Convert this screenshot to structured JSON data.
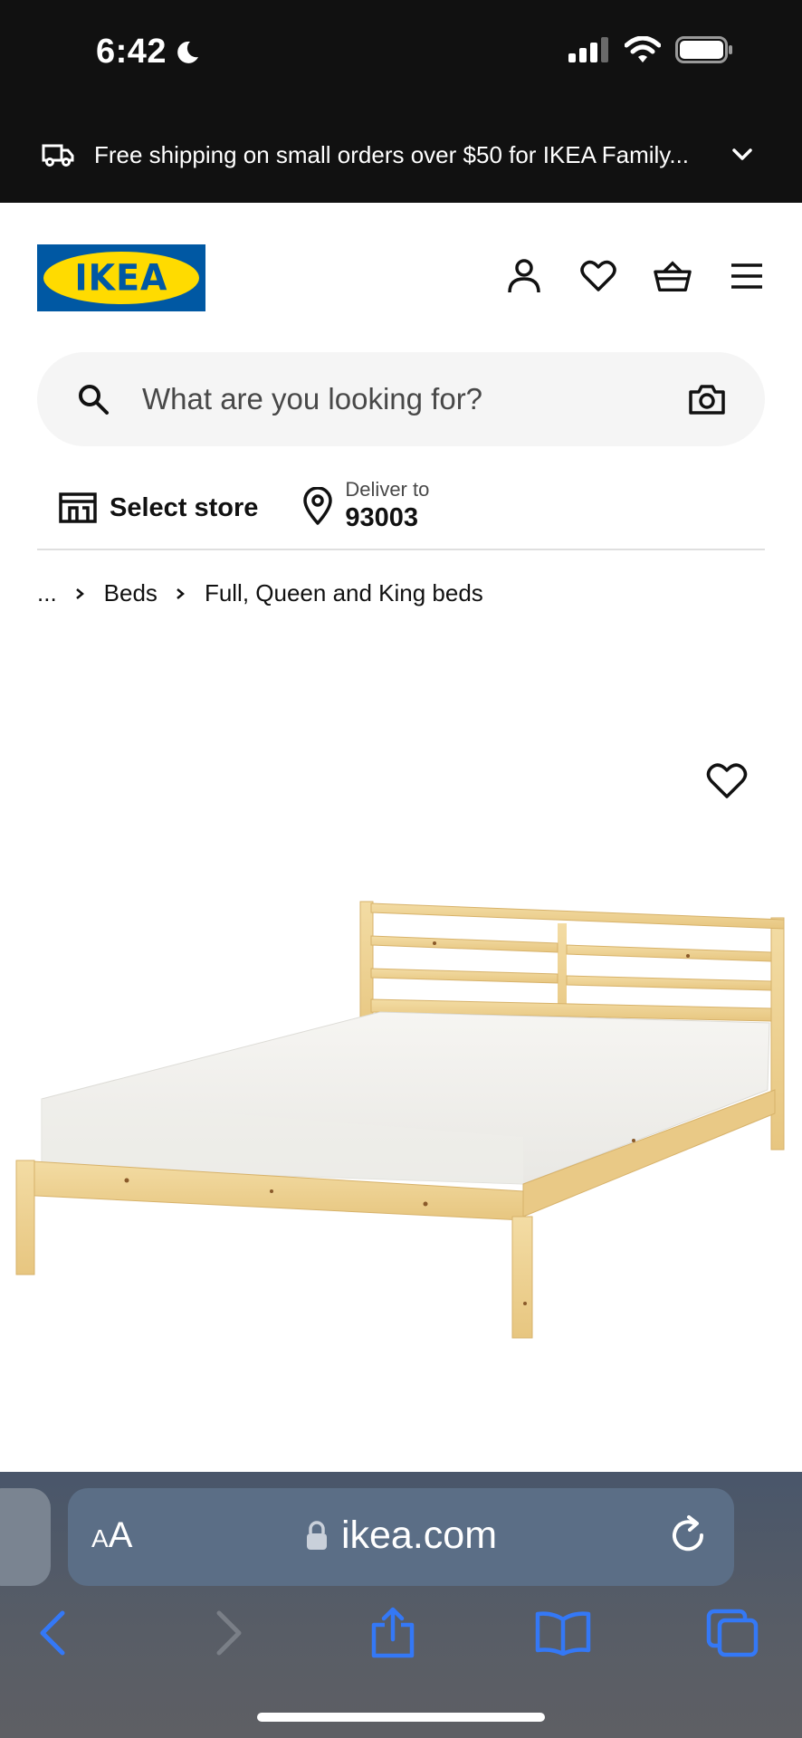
{
  "status_bar": {
    "time": "6:42",
    "icons": [
      "moon-icon",
      "cellular-signal-icon",
      "wifi-icon",
      "battery-icon"
    ]
  },
  "promo": {
    "icon": "delivery-truck-icon",
    "text": "Free shipping on small orders over $50 for IKEA Family...",
    "expand_icon": "chevron-down-icon"
  },
  "header": {
    "logo_text": "IKEA",
    "icons": [
      "account-icon",
      "heart-icon",
      "shopping-basket-icon",
      "menu-icon"
    ]
  },
  "search": {
    "placeholder": "What are you looking for?",
    "icons": [
      "search-icon",
      "camera-icon"
    ]
  },
  "store": {
    "select_store_label": "Select store",
    "deliver_label": "Deliver to",
    "deliver_zip": "93003"
  },
  "breadcrumb": {
    "items": [
      "...",
      "Beds",
      "Full, Queen and King beds"
    ]
  },
  "product": {
    "wishlist_icon": "heart-icon",
    "image": "pine-bed-frame-with-white-mattress"
  },
  "browser": {
    "aa_small": "A",
    "aa_big": "A",
    "url": "ikea.com",
    "nav_icons": [
      "back-icon",
      "forward-icon",
      "share-icon",
      "bookmarks-icon",
      "tabs-icon"
    ]
  },
  "colors": {
    "ikea_blue": "#0058a3",
    "ikea_yellow": "#ffdb00",
    "promo_bg": "#111111",
    "safari_blue": "#3478f6"
  }
}
